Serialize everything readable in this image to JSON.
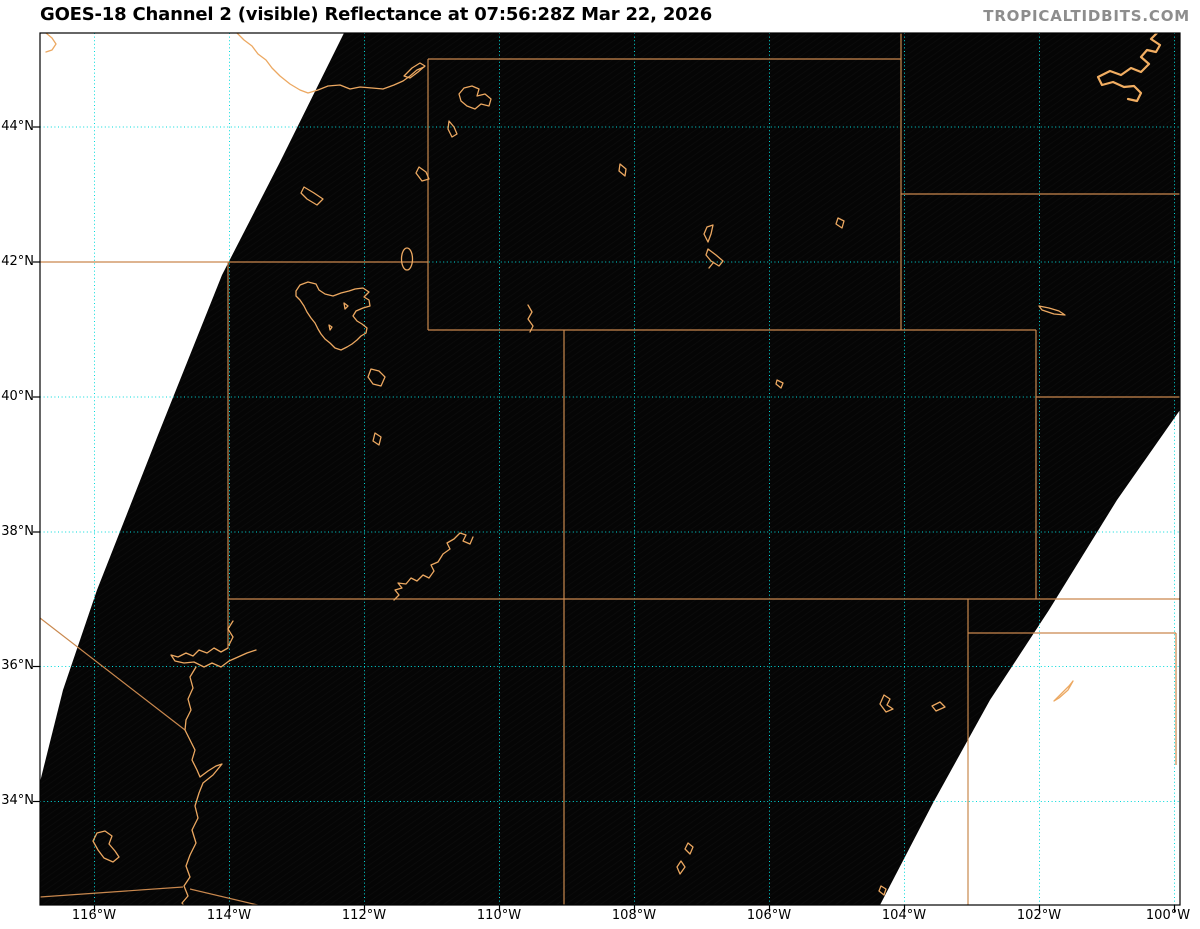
{
  "header": {
    "title": "GOES-18 Channel 2 (visible) Reflectance at 07:56:28Z Mar 22, 2026",
    "watermark": "TROPICALTIDBITS.COM"
  },
  "map": {
    "description": "GOES-18 visible-channel reflectance sector over the western/central US at night; black = no reflected sunlight, white diagonal wedges = outside scan sector",
    "region_lon_range": [
      "116°W",
      "100°W"
    ],
    "region_lat_range": [
      "34°N",
      "44°N"
    ]
  },
  "axes": {
    "lat_labels": [
      "44°N",
      "42°N",
      "40°N",
      "38°N",
      "36°N",
      "34°N"
    ],
    "lon_labels": [
      "116°W",
      "114°W",
      "112°W",
      "110°W",
      "108°W",
      "106°W",
      "104°W",
      "102°W",
      "100°W"
    ]
  },
  "colors": {
    "map_background": "#050505",
    "state_boundary_orange": "#c9884e",
    "water_orange": "#eca861",
    "bright_water_orange": "#f2ae62",
    "gridline_cyan": "#00dbdb",
    "no_data_white": "#ffffff",
    "title_color": "#000000",
    "watermark_gray": "#8d8d8d"
  }
}
